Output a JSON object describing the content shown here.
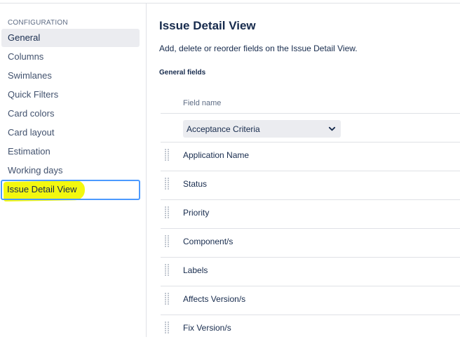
{
  "sidebar": {
    "heading": "CONFIGURATION",
    "items": [
      {
        "label": "General"
      },
      {
        "label": "Columns"
      },
      {
        "label": "Swimlanes"
      },
      {
        "label": "Quick Filters"
      },
      {
        "label": "Card colors"
      },
      {
        "label": "Card layout"
      },
      {
        "label": "Estimation"
      },
      {
        "label": "Working days"
      },
      {
        "label": "Issue Detail View"
      }
    ]
  },
  "main": {
    "title": "Issue Detail View",
    "description": "Add, delete or reorder fields on the Issue Detail View.",
    "section_title": "General fields",
    "column_header": "Field name",
    "select_value": "Acceptance Criteria",
    "fields": [
      {
        "label": "Application Name"
      },
      {
        "label": "Status"
      },
      {
        "label": "Priority"
      },
      {
        "label": "Component/s"
      },
      {
        "label": "Labels"
      },
      {
        "label": "Affects Version/s"
      },
      {
        "label": "Fix Version/s"
      }
    ]
  },
  "colors": {
    "accent_focus": "#4c9aff",
    "highlight": "#f3f80f",
    "selected_bg": "#ebecf0"
  }
}
